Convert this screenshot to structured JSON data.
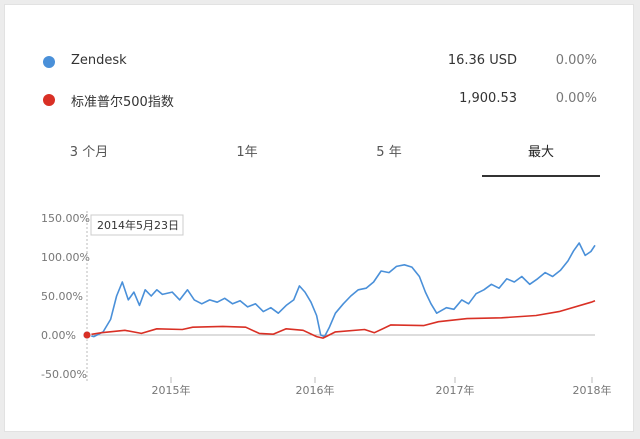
{
  "legend": [
    {
      "name": "Zendesk",
      "value": "16.36 USD",
      "change": "0.00%",
      "color": "#4a90d9"
    },
    {
      "name": "标准普尔500指数",
      "value": "1,900.53",
      "change": "0.00%",
      "color": "#d93025"
    }
  ],
  "tabs": [
    {
      "label": "3 个月",
      "active": false
    },
    {
      "label": "1年",
      "active": false
    },
    {
      "label": "5 年",
      "active": false
    },
    {
      "label": "最大",
      "active": true
    }
  ],
  "tooltip": {
    "date": "2014年5月23日"
  },
  "chart_data": {
    "type": "line",
    "x_start": "2014-05-23",
    "x_end": "2018-02",
    "x_ticks": [
      "2015年",
      "2016年",
      "2017年",
      "2018年"
    ],
    "y_ticks": [
      "150.00%",
      "100.00%",
      "50.00%",
      "0.00%",
      "-50.00%"
    ],
    "ylim": [
      -50,
      150
    ],
    "series": [
      {
        "name": "Zendesk",
        "color": "#4a90d9",
        "points": [
          [
            "2014-05-23",
            0
          ],
          [
            "2014-06-10",
            -2
          ],
          [
            "2014-07-05",
            4
          ],
          [
            "2014-07-25",
            20
          ],
          [
            "2014-08-10",
            50
          ],
          [
            "2014-08-25",
            68
          ],
          [
            "2014-09-10",
            45
          ],
          [
            "2014-09-25",
            55
          ],
          [
            "2014-10-10",
            38
          ],
          [
            "2014-10-25",
            58
          ],
          [
            "2014-11-10",
            50
          ],
          [
            "2014-11-25",
            58
          ],
          [
            "2014-12-10",
            52
          ],
          [
            "2015-01-05",
            55
          ],
          [
            "2015-01-25",
            45
          ],
          [
            "2015-02-15",
            58
          ],
          [
            "2015-03-05",
            45
          ],
          [
            "2015-03-25",
            40
          ],
          [
            "2015-04-15",
            45
          ],
          [
            "2015-05-05",
            42
          ],
          [
            "2015-05-25",
            47
          ],
          [
            "2015-06-15",
            40
          ],
          [
            "2015-07-05",
            44
          ],
          [
            "2015-07-25",
            36
          ],
          [
            "2015-08-15",
            40
          ],
          [
            "2015-09-05",
            30
          ],
          [
            "2015-09-25",
            35
          ],
          [
            "2015-10-15",
            28
          ],
          [
            "2015-11-05",
            38
          ],
          [
            "2015-11-25",
            45
          ],
          [
            "2015-12-10",
            63
          ],
          [
            "2015-12-25",
            55
          ],
          [
            "2016-01-10",
            42
          ],
          [
            "2016-01-25",
            25
          ],
          [
            "2016-02-05",
            0
          ],
          [
            "2016-02-15",
            -2
          ],
          [
            "2016-02-28",
            10
          ],
          [
            "2016-03-15",
            28
          ],
          [
            "2016-04-05",
            40
          ],
          [
            "2016-04-25",
            50
          ],
          [
            "2016-05-15",
            58
          ],
          [
            "2016-06-05",
            60
          ],
          [
            "2016-06-25",
            68
          ],
          [
            "2016-07-15",
            82
          ],
          [
            "2016-08-05",
            80
          ],
          [
            "2016-08-25",
            88
          ],
          [
            "2016-09-15",
            90
          ],
          [
            "2016-10-05",
            87
          ],
          [
            "2016-10-25",
            75
          ],
          [
            "2016-11-10",
            55
          ],
          [
            "2016-11-25",
            40
          ],
          [
            "2016-12-10",
            28
          ],
          [
            "2017-01-05",
            35
          ],
          [
            "2017-01-25",
            33
          ],
          [
            "2017-02-15",
            45
          ],
          [
            "2017-03-05",
            40
          ],
          [
            "2017-03-25",
            53
          ],
          [
            "2017-04-15",
            58
          ],
          [
            "2017-05-05",
            65
          ],
          [
            "2017-05-25",
            60
          ],
          [
            "2017-06-15",
            72
          ],
          [
            "2017-07-05",
            68
          ],
          [
            "2017-07-25",
            75
          ],
          [
            "2017-08-15",
            65
          ],
          [
            "2017-09-05",
            72
          ],
          [
            "2017-09-25",
            80
          ],
          [
            "2017-10-15",
            75
          ],
          [
            "2017-11-05",
            83
          ],
          [
            "2017-11-25",
            95
          ],
          [
            "2017-12-10",
            108
          ],
          [
            "2017-12-25",
            118
          ],
          [
            "2018-01-10",
            102
          ],
          [
            "2018-01-25",
            107
          ],
          [
            "2018-02-05",
            115
          ]
        ]
      },
      {
        "name": "标准普尔500指数",
        "color": "#d93025",
        "points": [
          [
            "2014-05-23",
            0
          ],
          [
            "2014-07-01",
            3
          ],
          [
            "2014-09-01",
            6
          ],
          [
            "2014-10-15",
            2
          ],
          [
            "2014-11-25",
            8
          ],
          [
            "2015-02-01",
            7
          ],
          [
            "2015-03-01",
            10
          ],
          [
            "2015-05-20",
            11
          ],
          [
            "2015-07-20",
            10
          ],
          [
            "2015-08-25",
            2
          ],
          [
            "2015-10-01",
            1
          ],
          [
            "2015-11-05",
            8
          ],
          [
            "2015-12-20",
            6
          ],
          [
            "2016-01-25",
            -2
          ],
          [
            "2016-02-11",
            -4
          ],
          [
            "2016-03-15",
            4
          ],
          [
            "2016-06-01",
            7
          ],
          [
            "2016-06-27",
            3
          ],
          [
            "2016-08-10",
            13
          ],
          [
            "2016-11-05",
            12
          ],
          [
            "2016-12-15",
            17
          ],
          [
            "2017-03-01",
            21
          ],
          [
            "2017-06-01",
            22
          ],
          [
            "2017-09-01",
            25
          ],
          [
            "2017-11-01",
            30
          ],
          [
            "2018-01-26",
            42
          ],
          [
            "2018-02-05",
            44
          ]
        ]
      }
    ]
  }
}
